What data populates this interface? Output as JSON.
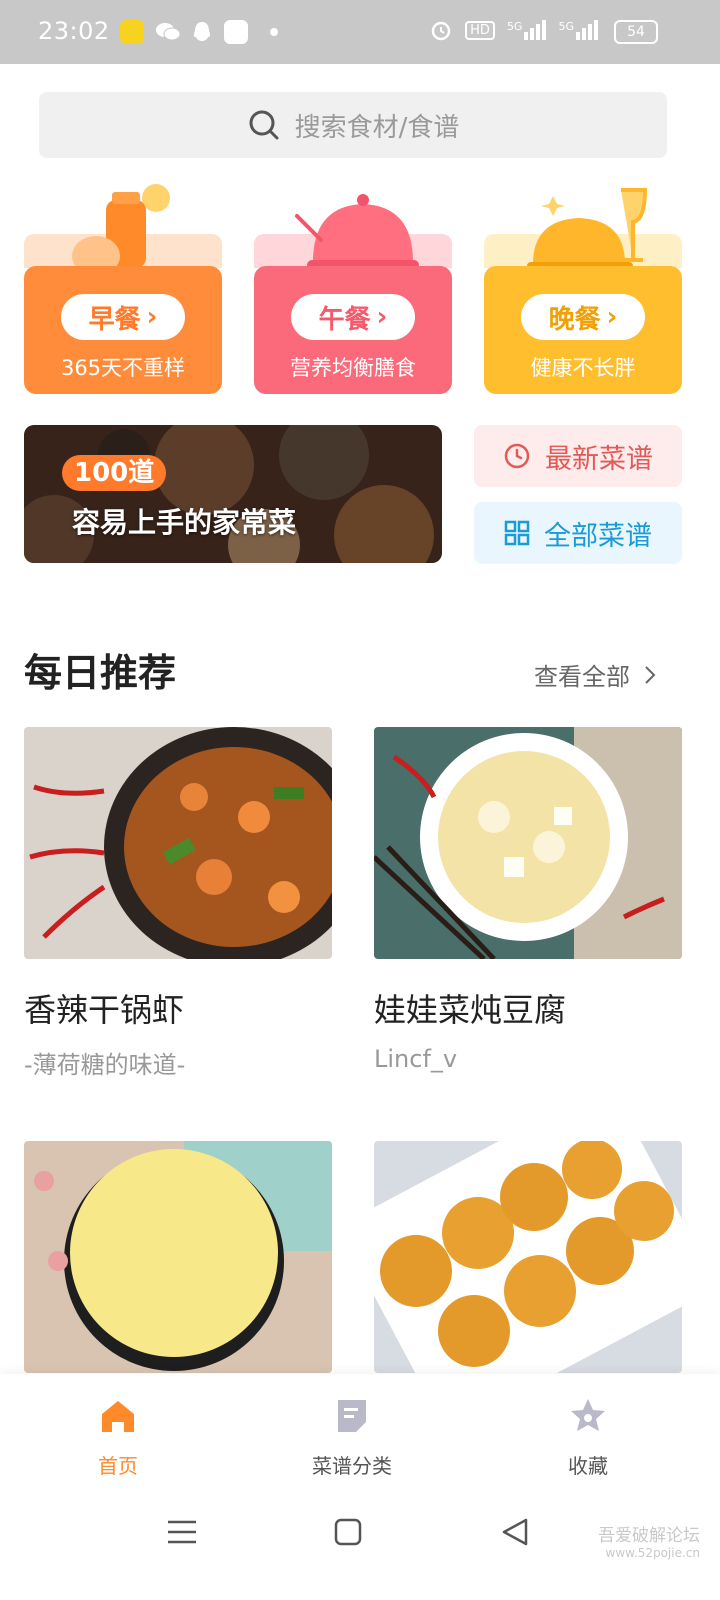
{
  "status_bar": {
    "time": "23:02",
    "network_1": "5G",
    "network_2": "5G",
    "hd_label": "HD",
    "battery": "54"
  },
  "search": {
    "placeholder": "搜索食材/食谱"
  },
  "meals": [
    {
      "label": "早餐",
      "subtitle": "365天不重样",
      "color": "#ff8c3a",
      "back_color": "#ffe2cc",
      "text_color": "#ff7a2a"
    },
    {
      "label": "午餐",
      "subtitle": "营养均衡膳食",
      "color": "#fb6a7a",
      "back_color": "#ffd6da",
      "text_color": "#f35a6b"
    },
    {
      "label": "晚餐",
      "subtitle": "健康不长胖",
      "color": "#ffbe2e",
      "back_color": "#ffefc4",
      "text_color": "#f0a10a"
    }
  ],
  "banner": {
    "badge": "100道",
    "title": "容易上手的家常菜"
  },
  "quick_links": {
    "latest": "最新菜谱",
    "all": "全部菜谱"
  },
  "daily": {
    "title": "每日推荐",
    "see_all": "查看全部"
  },
  "recipes": [
    {
      "name": "香辣干锅虾",
      "author": "-薄荷糖的味道-"
    },
    {
      "name": "娃娃菜炖豆腐",
      "author": "Lincf_v"
    },
    {
      "name": "",
      "author": ""
    },
    {
      "name": "",
      "author": ""
    }
  ],
  "tabs": {
    "home": "首页",
    "categories": "菜谱分类",
    "favorites": "收藏"
  },
  "watermark": {
    "line1": "吾爱破解论坛",
    "line2": "www.52pojie.cn"
  },
  "colors": {
    "accent": "#ff8a2a",
    "status_bar": "#c8c8c8",
    "search_bg": "#f0f0f0"
  }
}
